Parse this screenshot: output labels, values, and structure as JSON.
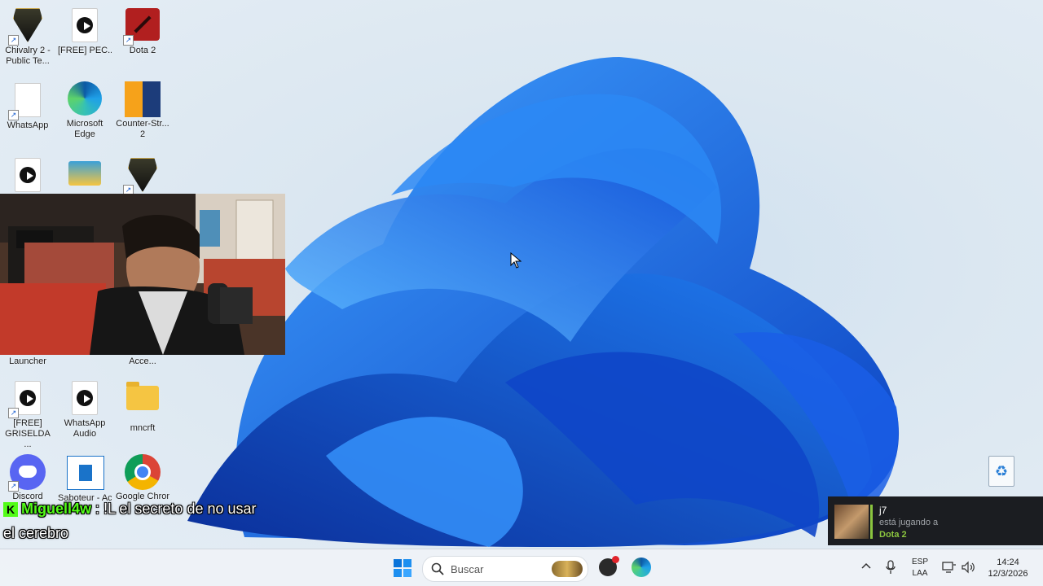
{
  "desktop_icons": [
    {
      "label": "Chivalry 2 - Public Te...",
      "icon": "chivalry-shield-icon"
    },
    {
      "label": "[FREE] PEC...",
      "icon": "media-file-icon"
    },
    {
      "label": "Dota 2",
      "icon": "dota-icon"
    },
    {
      "label": "WhatsApp",
      "icon": "blank-file-icon"
    },
    {
      "label": "Microsoft Edge",
      "icon": "edge-icon"
    },
    {
      "label": "Counter-Str... 2",
      "icon": "counter-strike-icon"
    },
    {
      "label": "Launcher",
      "icon": "launcher-icon"
    },
    {
      "label": "Acce...",
      "icon": "access-icon"
    },
    {
      "label": "[FREE] GRISELDA ...",
      "icon": "media-file-icon"
    },
    {
      "label": "WhatsApp Audio",
      "icon": "media-file-icon"
    },
    {
      "label": "mncrft",
      "icon": "folder-icon"
    },
    {
      "label": "Discord",
      "icon": "discord-icon"
    },
    {
      "label": "Saboteur - Access...",
      "icon": "saboteur-icon"
    },
    {
      "label": "Google Chrome",
      "icon": "chrome-icon"
    }
  ],
  "chat": {
    "username": "Miguell4w",
    "separator": ":",
    "message_line1": "!L el secreto de no usar",
    "message_line2": "el cerebro",
    "badge": "K"
  },
  "notification": {
    "name": "j7",
    "status": "está jugando a",
    "game": "Dota 2"
  },
  "taskbar": {
    "search_placeholder": "Buscar",
    "language_line1": "ESP",
    "language_line2": "LAA",
    "time": "14:24",
    "date": "12/3/2026"
  },
  "colors": {
    "taskbar_bg": "#eef2f7",
    "accent_green": "#53fc18",
    "steam_green": "#8bc53f",
    "bloom_blue": "#1565e0"
  }
}
